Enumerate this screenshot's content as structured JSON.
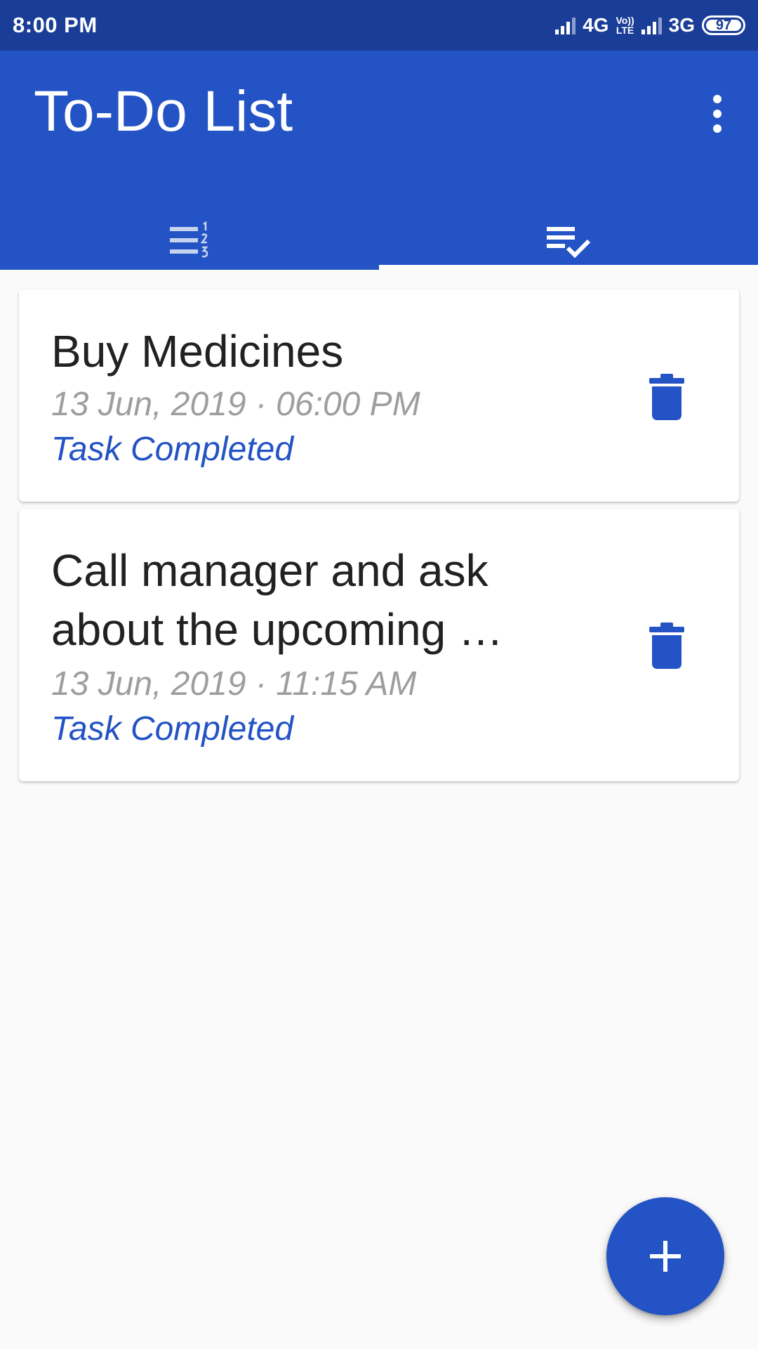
{
  "status_bar": {
    "time": "8:00 PM",
    "network_1": "4G",
    "volte_top": "Vo))",
    "volte_bottom": "LTE",
    "network_2": "3G",
    "battery": "97"
  },
  "app_bar": {
    "title": "To-Do List",
    "overflow_icon": "more-vert-icon"
  },
  "tabs": [
    {
      "icon": "numbered-list-icon",
      "active": false
    },
    {
      "icon": "playlist-check-icon",
      "active": true
    }
  ],
  "tasks": [
    {
      "title": "Buy Medicines",
      "datetime": "13 Jun, 2019 · 06:00 PM",
      "status": "Task Completed",
      "delete_icon": "trash-icon"
    },
    {
      "title": "Call manager and ask about the upcoming …",
      "datetime": "13 Jun, 2019 · 11:15 AM",
      "status": "Task Completed",
      "delete_icon": "trash-icon"
    }
  ],
  "fab": {
    "icon": "plus-icon"
  },
  "colors": {
    "primary": "#2353c4",
    "status_bar": "#1a3d97",
    "background": "#fafafa"
  }
}
